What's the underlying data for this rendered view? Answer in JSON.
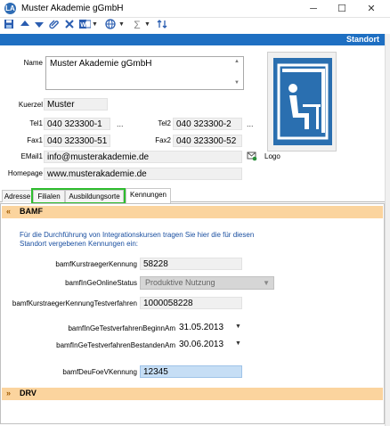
{
  "window": {
    "title": "Muster Akademie gGmbH",
    "app_icon": "LA",
    "minimize": "─",
    "maximize": "☐",
    "close": "✕"
  },
  "toolbar": {
    "icons": [
      "save-icon",
      "move-up-icon",
      "move-down-icon",
      "attach-icon",
      "delete-icon",
      "word-icon",
      "globe-icon",
      "sum-icon",
      "sort-icon"
    ]
  },
  "header": {
    "label": "Standort"
  },
  "form": {
    "name_label": "Name",
    "name_value": "Muster Akademie gGmbH",
    "kuerzel_label": "Kuerzel",
    "kuerzel_value": "Muster",
    "tel1_label": "Tel1",
    "tel1_value": "040 323300-1",
    "tel2_label": "Tel2",
    "tel2_value": "040 323300-2",
    "fax1_label": "Fax1",
    "fax1_value": "040 323300-51",
    "fax2_label": "Fax2",
    "fax2_value": "040 323300-52",
    "email_label": "EMail1",
    "email_value": "info@musterakademie.de",
    "homepage_label": "Homepage",
    "homepage_value": "www.musterakademie.de",
    "logo_label": "Logo",
    "dots": "..."
  },
  "tabs": [
    {
      "label": "Adresse"
    },
    {
      "label": "Filialen"
    },
    {
      "label": "Ausbildungsorte"
    },
    {
      "label": "Kennungen",
      "active": true
    }
  ],
  "bamf": {
    "title": "BAMF",
    "info": "Für die Durchführung von Integrationskursen tragen Sie hier die für diesen Standort vergebenen Kennungen ein:",
    "fields": [
      {
        "label": "bamfKurstraegerKennung",
        "value": "58228"
      },
      {
        "label": "bamfInGeOnlineStatus",
        "value": "Produktive Nutzung"
      },
      {
        "label": "bamfKurstraegerKennungTestverfahren",
        "value": "1000058228"
      },
      {
        "label": "bamfInGeTestverfahrenBeginnAm",
        "value": "31.05.2013"
      },
      {
        "label": "bamfInGeTestverfahrenBestandenAm",
        "value": "30.06.2013"
      },
      {
        "label": "bamfDeuFoeVKennung",
        "value": "12345"
      }
    ]
  },
  "drv": {
    "title": "DRV"
  },
  "colors": {
    "header_blue": "#1e6fc2",
    "section_orange": "#fbd49e",
    "highlight_green": "#2ebc2e",
    "info_text": "#1a4fa0"
  }
}
